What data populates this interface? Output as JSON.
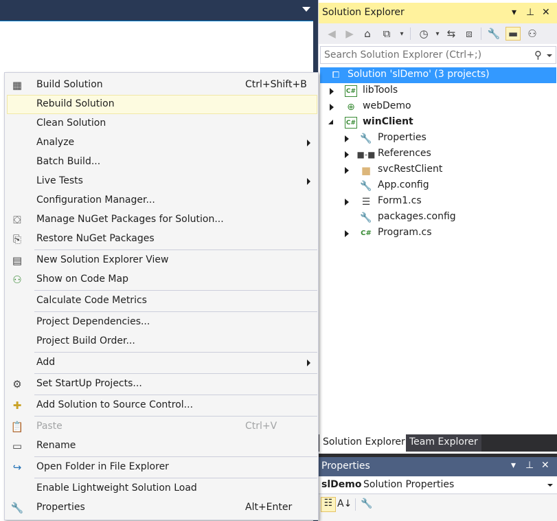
{
  "context_menu": {
    "items": [
      {
        "label": "Build Solution",
        "shortcut": "Ctrl+Shift+B",
        "icon": "build-icon"
      },
      {
        "label": "Rebuild Solution"
      },
      {
        "label": "Clean Solution"
      },
      {
        "label": "Analyze"
      },
      {
        "label": "Batch Build..."
      },
      {
        "label": "Live Tests"
      },
      {
        "label": "Configuration Manager..."
      },
      {
        "label": "Manage NuGet Packages for Solution...",
        "icon": "nuget-icon"
      },
      {
        "label": "Restore NuGet Packages",
        "icon": "restore-icon"
      },
      {
        "label": "New Solution Explorer View",
        "icon": "new-view-icon"
      },
      {
        "label": "Show on Code Map",
        "icon": "code-map-icon"
      },
      {
        "label": "Calculate Code Metrics"
      },
      {
        "label": "Project Dependencies..."
      },
      {
        "label": "Project Build Order..."
      },
      {
        "label": "Add"
      },
      {
        "label": "Set StartUp Projects...",
        "icon": "gear-icon"
      },
      {
        "label": "Add Solution to Source Control...",
        "icon": "source-control-icon"
      },
      {
        "label": "Paste",
        "shortcut": "Ctrl+V",
        "icon": "paste-icon"
      },
      {
        "label": "Rename",
        "icon": "rename-icon"
      },
      {
        "label": "Open Folder in File Explorer",
        "icon": "open-folder-icon"
      },
      {
        "label": "Enable Lightweight Solution Load"
      },
      {
        "label": "Properties",
        "shortcut": "Alt+Enter",
        "icon": "wrench-icon"
      }
    ]
  },
  "solution_explorer": {
    "title": "Solution Explorer",
    "search_placeholder": "Search Solution Explorer (Ctrl+;)",
    "tree": [
      {
        "label": "Solution 'slDemo' (3 projects)"
      },
      {
        "label": "libTools"
      },
      {
        "label": "webDemo"
      },
      {
        "label": "winClient"
      },
      {
        "label": "Properties"
      },
      {
        "label": "References"
      },
      {
        "label": "svcRestClient"
      },
      {
        "label": "App.config"
      },
      {
        "label": "Form1.cs"
      },
      {
        "label": "packages.config"
      },
      {
        "label": "Program.cs"
      }
    ],
    "tabs": [
      "Solution Explorer",
      "Team Explorer"
    ]
  },
  "properties": {
    "title": "Properties",
    "object_name": "slDemo",
    "object_type": "Solution Properties"
  },
  "colors": {
    "accent": "#007acc",
    "title_highlight": "#fff29d",
    "selection": "#3399ff",
    "menu_highlight": "#fdfbe0"
  }
}
